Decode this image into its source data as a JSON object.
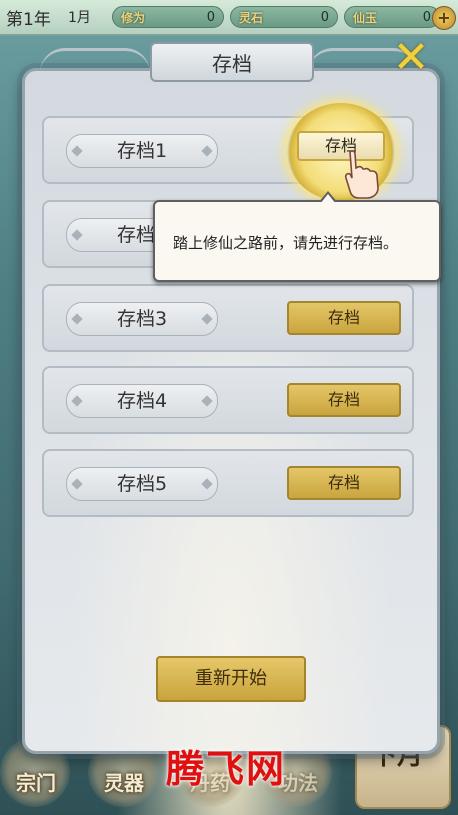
{
  "status_bar": {
    "year": "第1年",
    "month": "1月",
    "resources": [
      {
        "label": "修为",
        "value": "0"
      },
      {
        "label": "灵石",
        "value": "0"
      },
      {
        "label": "仙玉",
        "value": "0"
      }
    ],
    "plus_symbol": "+"
  },
  "dialog": {
    "title": "存档",
    "close_symbol": "✕",
    "slots": [
      {
        "label": "存档1",
        "button": "存档"
      },
      {
        "label": "存档2",
        "button": "存档"
      },
      {
        "label": "存档3",
        "button": "存档"
      },
      {
        "label": "存档4",
        "button": "存档"
      },
      {
        "label": "存档5",
        "button": "存档"
      }
    ],
    "tooltip": "踏上修仙之路前，请先进行存档。",
    "restart_button": "重新开始"
  },
  "bottom_nav": {
    "items": [
      "宗门",
      "灵器",
      "丹药",
      "功法"
    ],
    "next_month": "下月"
  },
  "watermark": "腾飞网",
  "colors": {
    "gold_button": "#d6b44f",
    "panel": "#dde2e7",
    "watermark": "#e01010"
  }
}
